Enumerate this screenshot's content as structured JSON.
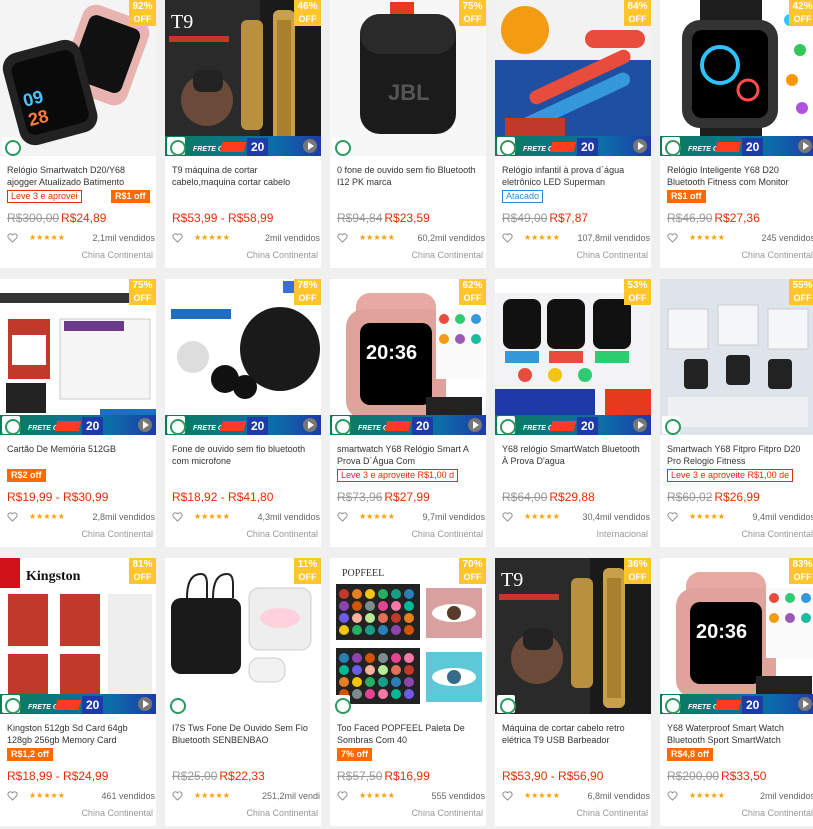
{
  "cards": [
    {
      "off": "92%",
      "off_word": "OFF",
      "title": "Relógio Smartwatch D20/Y68 ajogger Atualizado Batimento Cardíaco",
      "badge": "Leve 3 e aprovei",
      "badge2": "R$1 off",
      "price_old": "R$300,00",
      "price": "R$24,89",
      "stars": "★★★★★",
      "sold": "2,1mil vendidos",
      "origin": "China Continental",
      "art": "watch-pair",
      "banner": false
    },
    {
      "off": "46%",
      "off_word": "OFF",
      "title": "T9 máquina de cortar cabelo,maquina cortar cabelo",
      "badge": "",
      "badge2": "",
      "price_old": "",
      "price": "R$53,99 - R$58,99",
      "stars": "★★★★★",
      "sold": "2mil vendidos",
      "origin": "China Continental",
      "art": "trimmer",
      "banner": true
    },
    {
      "off": "75%",
      "off_word": "OFF",
      "title": "0 fone de ouvido sem fio Bluetooth I12 PK marca",
      "badge": "",
      "badge2": "",
      "price_old": "R$94,84",
      "price": "R$23,59",
      "stars": "★★★★★",
      "sold": "60,2mil vendidos",
      "origin": "China Continental",
      "art": "jbl",
      "banner": false
    },
    {
      "off": "84%",
      "off_word": "OFF",
      "title": "Relógio infantil à prova d`água eletrônico LED Superman",
      "badge": "Atacado",
      "badge2": "",
      "price_old": "R$49,00",
      "price": "R$7,87",
      "stars": "★★★★★",
      "sold": "107,8mil vendidos",
      "origin": "China Continental",
      "art": "kids",
      "banner": true
    },
    {
      "off": "42%",
      "off_word": "OFF",
      "title": "Relógio Inteligente Y68 D20 Bluetooth Fitness com Monitor",
      "badge": "R$1 off",
      "badge2": "",
      "price_old": "R$46,90",
      "price": "R$27,36",
      "stars": "★★★★★",
      "sold": "245 vendidos",
      "origin": "China Continental",
      "art": "watch-black",
      "banner": true
    },
    {
      "off": "75%",
      "off_word": "OFF",
      "title": "Cartão De Memória 512GB",
      "badge": "R$2 off",
      "badge2": "",
      "price_old": "",
      "price": "R$19,99 - R$30,99",
      "stars": "★★★★★",
      "sold": "2,8mil vendidos",
      "origin": "China Continental",
      "art": "sdcard",
      "banner": true
    },
    {
      "off": "78%",
      "off_word": "OFF",
      "title": "Fone de ouvido sem fio bluetooth com microfone",
      "badge": "",
      "badge2": "",
      "price_old": "",
      "price": "R$18,92 - R$41,80",
      "stars": "★★★★★",
      "sold": "4,3mil vendidos",
      "origin": "China Continental",
      "art": "earbuds-black",
      "banner": true
    },
    {
      "off": "62%",
      "off_word": "OFF",
      "title": "smartwatch Y68 Relógio Smart A Prova D´Água Com",
      "badge": "Leve 3 e aproveite R$1,00 d",
      "badge2": "",
      "price_old": "R$73,96",
      "price": "R$27,99",
      "stars": "★★★★★",
      "sold": "9,7mil vendidos",
      "origin": "China Continental",
      "art": "watch-pink",
      "banner": true
    },
    {
      "off": "53%",
      "off_word": "OFF",
      "title": "Y68 relógio SmartWatch Bluetooth À Prova D'agua",
      "badge": "",
      "badge2": "",
      "price_old": "R$64,00",
      "price": "R$29,88",
      "stars": "★★★★★",
      "sold": "30,4mil vendidos",
      "origin": "Internacional",
      "art": "watch-multi",
      "banner": true
    },
    {
      "off": "55%",
      "off_word": "OFF",
      "title": "Smartwach Y68 Fitpro Fitpro D20 Pro Relogio Fitness",
      "badge": "Leve 3 e aproveite R$1,00 de",
      "badge2": "",
      "price_old": "R$60,02",
      "price": "R$26,99",
      "stars": "★★★★★",
      "sold": "9,4mil vendidos",
      "origin": "China Continental",
      "art": "watch-boxes",
      "banner": false
    },
    {
      "off": "81%",
      "off_word": "OFF",
      "title": "Kingston 512gb Sd Card 64gb 128gb 256gb Memory Card",
      "badge": "R$1,2 off",
      "badge2": "",
      "price_old": "",
      "price": "R$18,99 - R$24,99",
      "stars": "★★★★★",
      "sold": "461 vendidos",
      "origin": "China Continental",
      "art": "kingston",
      "banner": true
    },
    {
      "off": "11%",
      "off_word": "OFF",
      "title": "I7S Tws Fone De Ouvido Sem Fio Bluetooth SENBENBAO",
      "badge": "",
      "badge2": "",
      "price_old": "R$25,00",
      "price": "R$22,33",
      "stars": "★★★★★",
      "sold": "251,2mil vendi",
      "origin": "China Continental",
      "art": "i7s",
      "banner": false
    },
    {
      "off": "70%",
      "off_word": "OFF",
      "title": "Too Faced POPFEEL Paleta De Sombras Com 40",
      "badge": "7% off",
      "badge2": "",
      "price_old": "R$57,50",
      "price": "R$16,99",
      "stars": "★★★★★",
      "sold": "555 vendidos",
      "origin": "China Continental",
      "art": "palette",
      "banner": false
    },
    {
      "off": "36%",
      "off_word": "OFF",
      "title": "Máquina de cortar cabelo retro elétrica T9 USB Barbeador",
      "badge": "",
      "badge2": "",
      "price_old": "",
      "price": "R$53,90 - R$56,90",
      "stars": "★★★★★",
      "sold": "6,8mil vendidos",
      "origin": "China Continental",
      "art": "trimmer",
      "banner": false
    },
    {
      "off": "83%",
      "off_word": "OFF",
      "title": "Y68 Waterproof Smart Watch Bluetooth Sport SmartWatch",
      "badge": "R$4,8 off",
      "badge2": "",
      "price_old": "R$200,00",
      "price": "R$33,50",
      "stars": "★★★★★",
      "sold": "2mil vendidos",
      "origin": "China Continental",
      "art": "watch-pink",
      "banner": true
    }
  ],
  "banner": {
    "frete": "FRETE GRÁTIS",
    "value": "20"
  },
  "colors": {
    "price": "#e62e04",
    "off_badge": "#ffc52c",
    "star": "#ff9f00"
  }
}
